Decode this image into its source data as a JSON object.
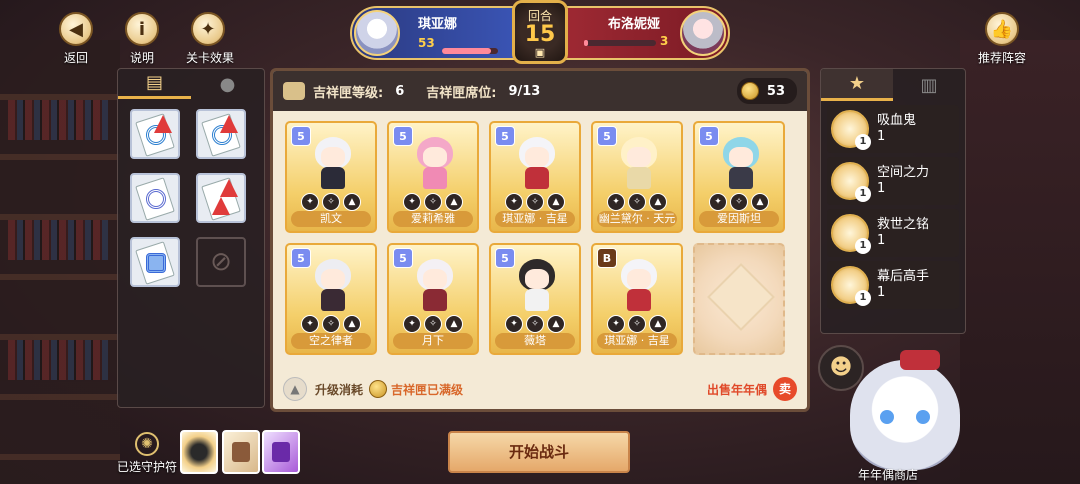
{
  "top_left": {
    "back_label": "返回",
    "help_label": "说明",
    "stage_effect_label": "关卡效果"
  },
  "versus": {
    "round_label": "回合",
    "round_number": "15",
    "left": {
      "name": "琪亚娜",
      "hp": "53",
      "hp_fraction": 0.88
    },
    "right": {
      "name": "布洛妮娅",
      "hp": "3",
      "hp_fraction": 0.05
    }
  },
  "top_right": {
    "recommend_label": "推荐阵容"
  },
  "main": {
    "box_level_label": "吉祥匣等级:",
    "box_level": "6",
    "box_seats_label": "吉祥匣席位:",
    "box_seats": "9/13",
    "coins": "53",
    "units": [
      {
        "level": "5",
        "name": "凯文",
        "head": "#f2f2f6",
        "body": "#2b2b38",
        "bronze": false
      },
      {
        "level": "5",
        "name": "爱莉希雅",
        "head": "#f4a8c8",
        "body": "#f08ab4",
        "bronze": false
      },
      {
        "level": "5",
        "name": "琪亚娜 · 吉星",
        "head": "#f4f4f8",
        "body": "#c0303a",
        "bronze": false
      },
      {
        "level": "5",
        "name": "幽兰黛尔 · 天元",
        "head": "#fff1c8",
        "body": "#e9d9a8",
        "bronze": false
      },
      {
        "level": "5",
        "name": "爱因斯坦",
        "head": "#8fd6e8",
        "body": "#3a3a48",
        "bronze": false
      },
      {
        "level": "5",
        "name": "空之律者",
        "head": "#ededf2",
        "body": "#3a2a34",
        "bronze": false
      },
      {
        "level": "5",
        "name": "月下",
        "head": "#f4f0f4",
        "body": "#8a2a34",
        "bronze": false
      },
      {
        "level": "5",
        "name": "薇塔",
        "head": "#2e2a2a",
        "body": "#f2f2f2",
        "bronze": false
      },
      {
        "level": "B",
        "name": "琪亚娜 · 吉星",
        "head": "#f4f4f8",
        "body": "#c0303a",
        "bronze": true
      }
    ],
    "upgrade_cost_label": "升级消耗",
    "box_full_label": "吉祥匣已满级",
    "sell_label": "出售年年偶"
  },
  "traits": [
    {
      "name": "吸血鬼",
      "count": "1"
    },
    {
      "name": "空间之力",
      "count": "1"
    },
    {
      "name": "救世之铭",
      "count": "1"
    },
    {
      "name": "幕后高手",
      "count": "1"
    }
  ],
  "bottom": {
    "amulet_label": "已选守护符",
    "start_label": "开始战斗",
    "shop_label": "年年偶商店"
  },
  "colors": {
    "accent_gold": "#e9b24a",
    "left_team": "#3b56b8",
    "right_team": "#a02a34"
  },
  "icons": {
    "back": "arrow-left-icon",
    "help": "info-icon",
    "stage": "compass-star-icon",
    "recommend": "thumbs-up-icon",
    "coin": "coin-icon"
  }
}
